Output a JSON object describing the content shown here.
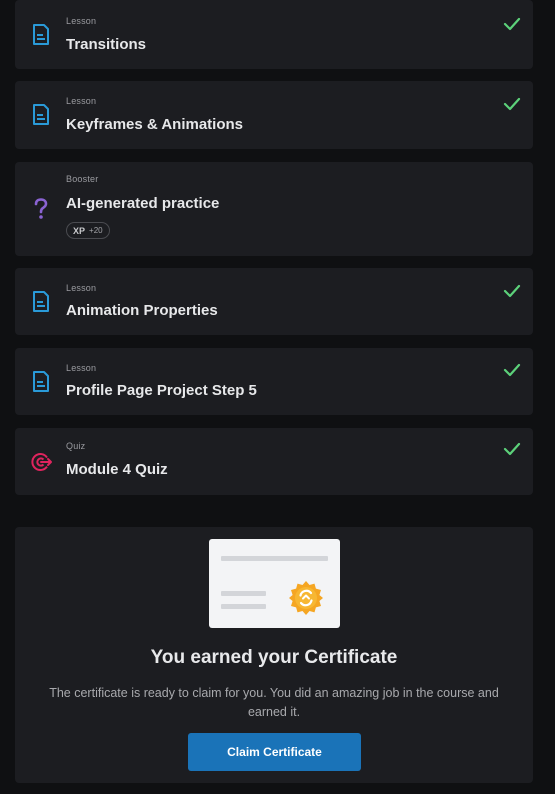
{
  "items": [
    {
      "type": "Lesson",
      "title": "Transitions",
      "icon": "lesson-doc-icon",
      "completed": true
    },
    {
      "type": "Lesson",
      "title": "Keyframes & Animations",
      "icon": "lesson-doc-icon",
      "completed": true
    },
    {
      "type": "Booster",
      "title": "AI-generated practice",
      "icon": "question-mark-icon",
      "completed": false,
      "xp_label": "XP",
      "xp_value": "+20"
    },
    {
      "type": "Lesson",
      "title": "Animation Properties",
      "icon": "lesson-doc-icon",
      "completed": true
    },
    {
      "type": "Lesson",
      "title": "Profile Page Project Step 5",
      "icon": "lesson-doc-icon",
      "completed": true
    },
    {
      "type": "Quiz",
      "title": "Module 4 Quiz",
      "icon": "target-icon",
      "completed": true
    }
  ],
  "certificate": {
    "title": "You earned your Certificate",
    "description": "The certificate is ready to claim for you. You did an amazing job in the course and earned it.",
    "button_label": "Claim Certificate",
    "image_icon": "certificate-seal-icon"
  },
  "colors": {
    "background": "#0f1012",
    "card": "#1c1d21",
    "lesson_icon": "#2a9ad8",
    "booster_icon": "#8a63d2",
    "quiz_icon": "#e0245e",
    "check": "#5cd17a",
    "button": "#1a73b8",
    "seal": "#f5a623"
  }
}
